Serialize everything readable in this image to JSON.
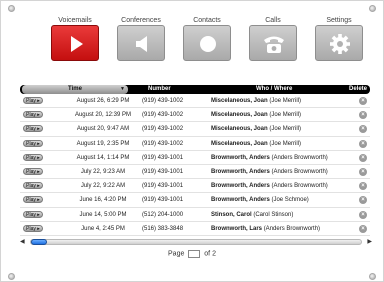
{
  "nav": [
    {
      "label": "Voicemails",
      "icon": "play-icon",
      "active": true
    },
    {
      "label": "Conferences",
      "icon": "megaphone-icon",
      "active": false
    },
    {
      "label": "Contacts",
      "icon": "circle-icon",
      "active": false
    },
    {
      "label": "Calls",
      "icon": "phone-icon",
      "active": false
    },
    {
      "label": "Settings",
      "icon": "gear-icon",
      "active": false
    }
  ],
  "table": {
    "headers": {
      "time": "Time",
      "number": "Number",
      "who": "Who / Where",
      "delete": "Delete"
    },
    "play_label": "Play ▸",
    "delete_label": "×",
    "rows": [
      {
        "time": "August 26, 6:29 PM",
        "number": "(919) 439-1002",
        "name": "Miscelaneous, Joan",
        "who": "(Joe Merrill)"
      },
      {
        "time": "August 20, 12:39 PM",
        "number": "(919) 439-1002",
        "name": "Miscelaneous, Joan",
        "who": "(Joe Merrill)"
      },
      {
        "time": "August 20, 9:47 AM",
        "number": "(919) 439-1002",
        "name": "Miscelaneous, Joan",
        "who": "(Joe Merrill)"
      },
      {
        "time": "August 19, 2:35 PM",
        "number": "(919) 439-1002",
        "name": "Miscelaneous, Joan",
        "who": "(Joe Merrill)"
      },
      {
        "time": "August 14, 1:14 PM",
        "number": "(919) 439-1001",
        "name": "Brownworth, Anders",
        "who": "(Anders Brownworth)"
      },
      {
        "time": "July 22, 9:23 AM",
        "number": "(919) 439-1001",
        "name": "Brownworth, Anders",
        "who": "(Anders Brownworth)"
      },
      {
        "time": "July 22, 9:22 AM",
        "number": "(919) 439-1001",
        "name": "Brownworth, Anders",
        "who": "(Anders Brownworth)"
      },
      {
        "time": "June 16, 4:20 PM",
        "number": "(919) 439-1001",
        "name": "Brownworth, Anders",
        "who": "(Joe Schmoe)"
      },
      {
        "time": "June 14, 5:00 PM",
        "number": "(512) 204-1000",
        "name": "Stinson, Carol",
        "who": "(Carol Stinson)"
      },
      {
        "time": "June 4, 2:45 PM",
        "number": "(516) 383-3848",
        "name": "Brownworth, Lars",
        "who": "(Anders Brownworth)"
      }
    ]
  },
  "scroll": {
    "left": "◀",
    "right": "▶"
  },
  "pager": {
    "page_label": "Page",
    "of_label": "of 2"
  },
  "colors": {
    "active_tile": "#d21515",
    "inactive_tile": "#b8b8b8",
    "header_bg": "#000000",
    "thumb": "#2f7ee8"
  }
}
